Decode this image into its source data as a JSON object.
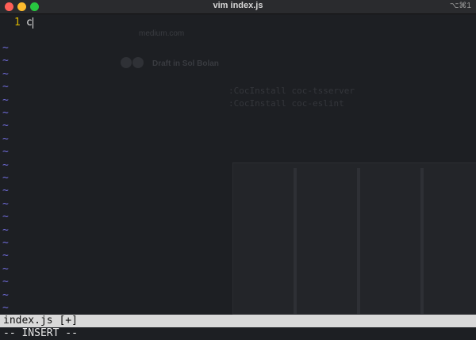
{
  "window": {
    "title": "vim index.js",
    "shortcut": "⌥⌘1"
  },
  "editor": {
    "line_number": "1",
    "line_text": "c",
    "tilde": "~",
    "empty_line_count": 22,
    "colors": {
      "line_number": "#d9b600",
      "tilde": "#6f6bd8",
      "text": "#e6e6e6"
    }
  },
  "status": {
    "file": "index.js [+]",
    "mode": "-- INSERT --"
  },
  "background_ghost": {
    "url": "medium.com",
    "author": "Draft in Sol Bolan",
    "cmd1": ":CocInstall coc-tsserver",
    "cmd2": ":CocInstall coc-eslint"
  }
}
